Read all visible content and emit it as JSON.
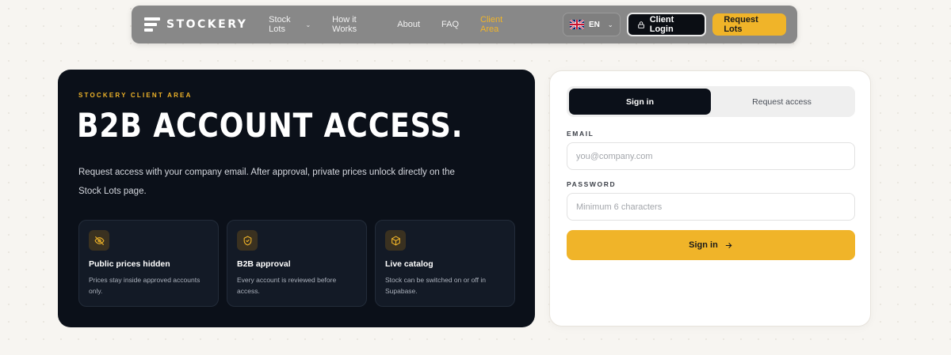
{
  "nav": {
    "logo_text": "STOCKERY",
    "links": [
      {
        "label": "Stock Lots",
        "has_dropdown": true
      },
      {
        "label": "How it Works"
      },
      {
        "label": "About"
      },
      {
        "label": "FAQ"
      },
      {
        "label": "Client Area",
        "active": true
      }
    ],
    "language": "EN",
    "login_label": "Client Login",
    "request_label": "Request Lots"
  },
  "hero": {
    "eyebrow": "STOCKERY CLIENT AREA",
    "title": "B2B ACCOUNT ACCESS.",
    "description": "Request access with your company email. After approval, private prices unlock directly on the Stock Lots page.",
    "features": [
      {
        "icon": "eye-off-icon",
        "title": "Public prices hidden",
        "text": "Prices stay inside approved accounts only."
      },
      {
        "icon": "shield-check-icon",
        "title": "B2B approval",
        "text": "Every account is reviewed before access."
      },
      {
        "icon": "box-icon",
        "title": "Live catalog",
        "text": "Stock can be switched on or off in Supabase."
      }
    ]
  },
  "form": {
    "tabs": [
      "Sign in",
      "Request access"
    ],
    "active_tab": "Sign in",
    "email_label": "EMAIL",
    "email_placeholder": "you@company.com",
    "password_label": "PASSWORD",
    "password_placeholder": "Minimum 6 characters",
    "submit_label": "Sign in"
  },
  "colors": {
    "accent": "#f0b429",
    "dark": "#0b1019",
    "nav_bg": "#888888"
  }
}
